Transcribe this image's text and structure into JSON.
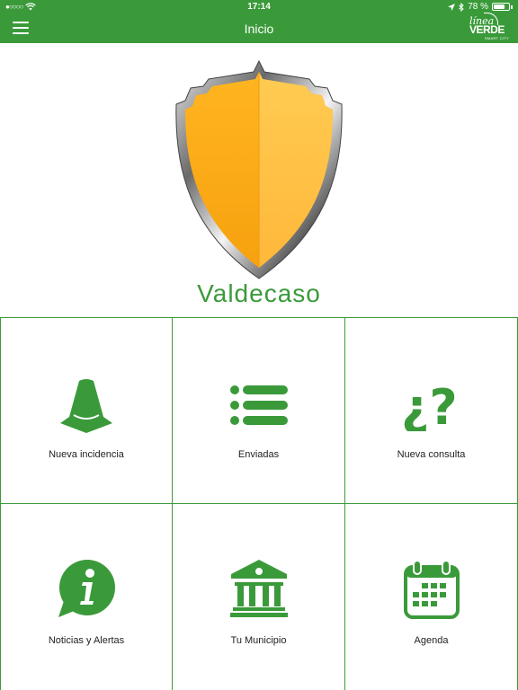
{
  "status_bar": {
    "time": "17:14",
    "battery": "78 %",
    "battery_level": 0.78,
    "signal_icon": "signal-dots-icon",
    "wifi_icon": "wifi-icon",
    "location_icon": "location-arrow-icon",
    "bluetooth_icon": "bluetooth-icon"
  },
  "nav": {
    "title": "Inicio",
    "menu_icon": "hamburger-menu-icon",
    "logo": {
      "line1": "línea",
      "line2": "VERDE",
      "line3": "SMART CITY"
    }
  },
  "town": {
    "name": "Valdecaso"
  },
  "colors": {
    "brand_green": "#3a9a3a",
    "shield_gold": "#ffad1f"
  },
  "tiles": [
    {
      "label": "Nueva incidencia",
      "icon": "traffic-cone-icon"
    },
    {
      "label": "Enviadas",
      "icon": "list-icon"
    },
    {
      "label": "Nueva consulta",
      "icon": "question-marks-icon"
    },
    {
      "label": "Noticias y Alertas",
      "icon": "info-bubble-icon"
    },
    {
      "label": "Tu Municipio",
      "icon": "town-hall-icon"
    },
    {
      "label": "Agenda",
      "icon": "calendar-icon"
    }
  ]
}
